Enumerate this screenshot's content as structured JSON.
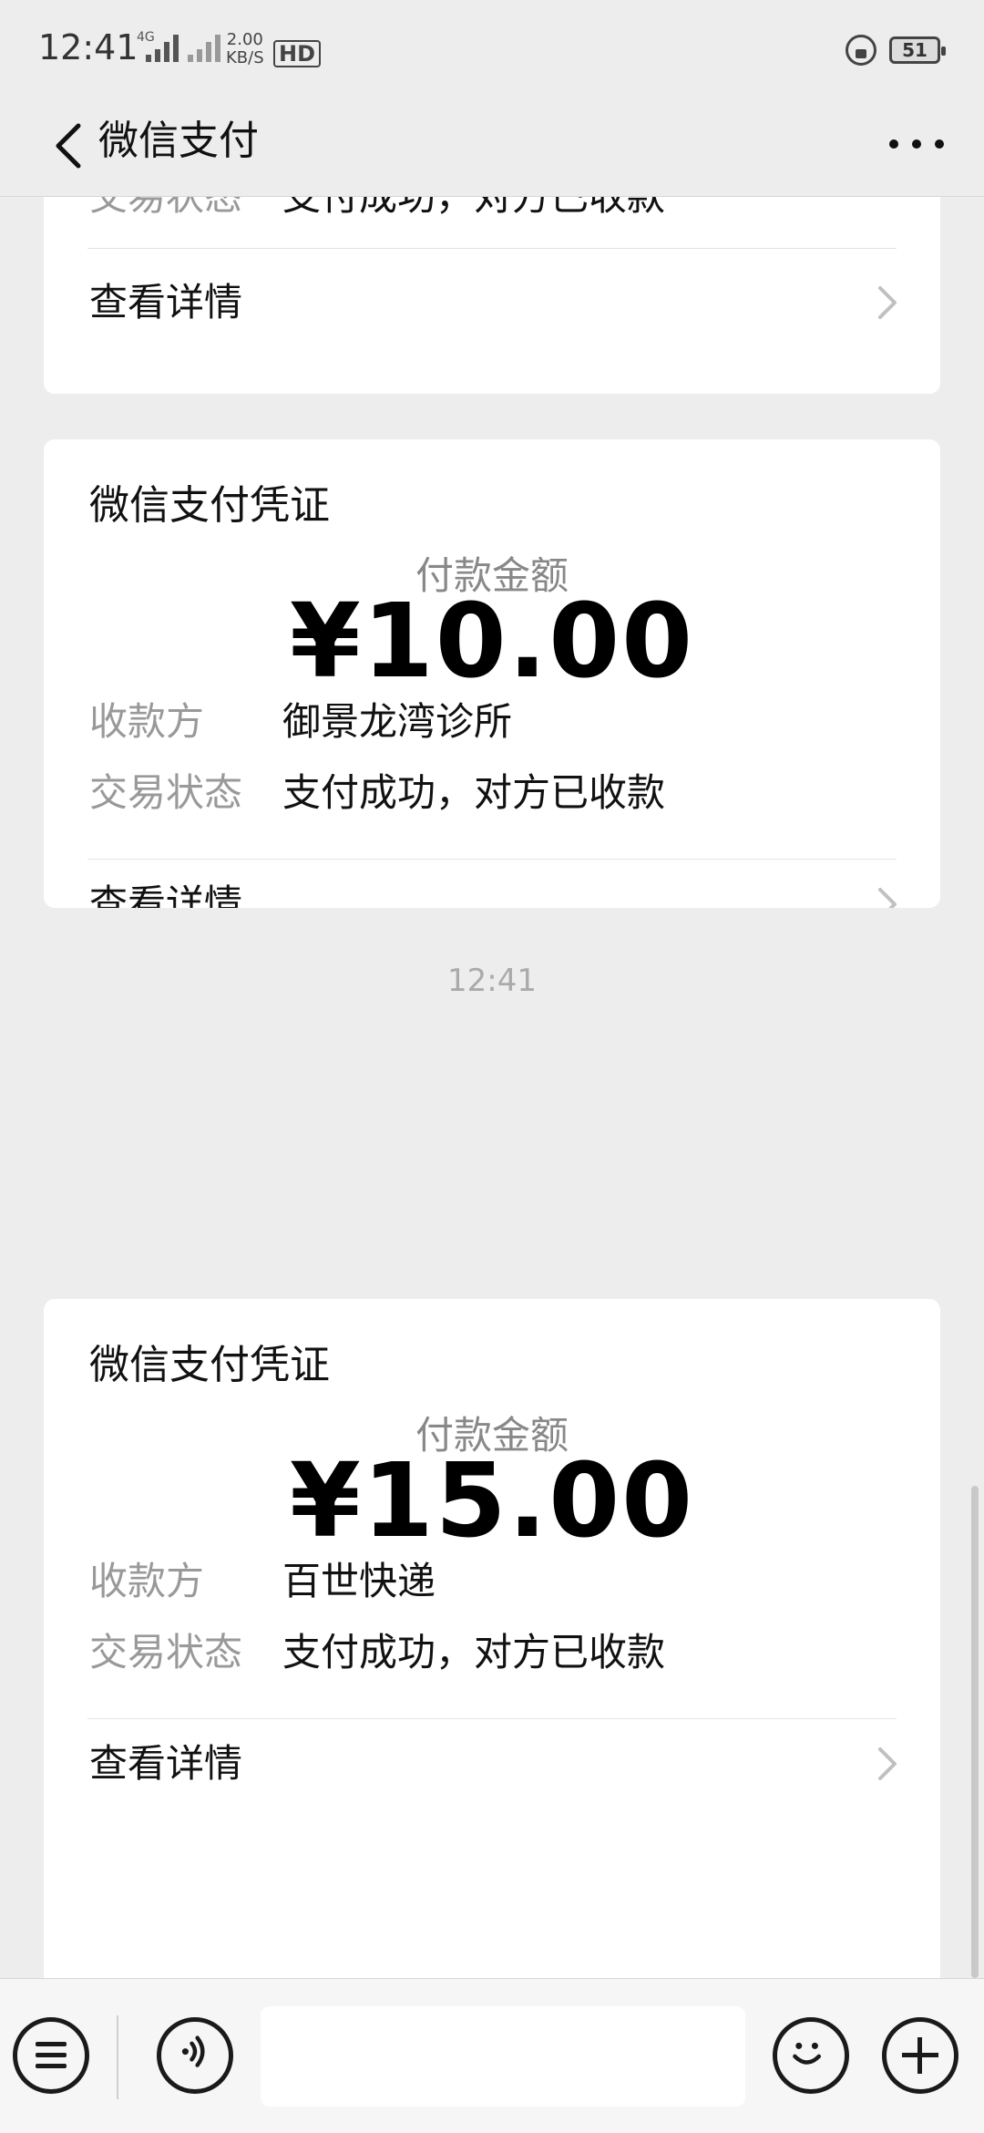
{
  "status_bar": {
    "time": "12:41",
    "network_type": "4G",
    "net_speed_value": "2.00",
    "net_speed_unit": "KB/S",
    "hd_label": "HD",
    "battery_level": "51"
  },
  "nav": {
    "title": "微信支付",
    "back_icon": "chevron-left-icon",
    "more_icon": "more-dots-icon"
  },
  "partial_card": {
    "status_label": "交易状态",
    "status_value": "支付成功，对方已收款",
    "detail_link": "查看详情"
  },
  "receipts": [
    {
      "title": "微信支付凭证",
      "amount_label": "付款金额",
      "amount": "¥10.00",
      "payee_label": "收款方",
      "payee": "御景龙湾诊所",
      "status_label": "交易状态",
      "status": "支付成功，对方已收款",
      "detail_link": "查看详情"
    },
    {
      "title": "微信支付凭证",
      "amount_label": "付款金额",
      "amount": "¥15.00",
      "payee_label": "收款方",
      "payee": "百世快递",
      "status_label": "交易状态",
      "status": "支付成功，对方已收款",
      "detail_link": "查看详情"
    }
  ],
  "timestamp": "12:41",
  "input_bar": {
    "menu_icon": "menu-lines-icon",
    "voice_icon": "voice-icon",
    "emoji_icon": "emoji-icon",
    "plus_icon": "plus-icon",
    "message_value": ""
  },
  "colors": {
    "page_background": "#ededed",
    "card_background": "#ffffff",
    "muted_text": "#999999"
  }
}
